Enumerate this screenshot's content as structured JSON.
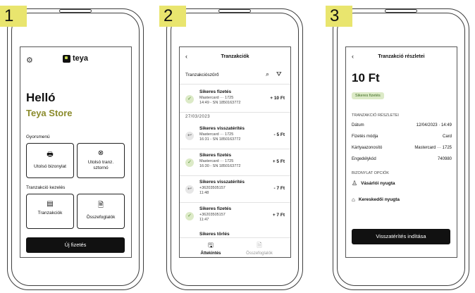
{
  "steps": [
    "1",
    "2",
    "3"
  ],
  "screen1": {
    "brand": "teya",
    "greeting": "Helló",
    "store": "Teya Store",
    "quick_menu_title": "Gyorsmenü",
    "tile_last_receipt": "Utolsó bizonylat",
    "tile_last_tx_cancel_l1": "Utolsó tranz.",
    "tile_last_tx_cancel_l2": "sztornó",
    "tx_manage_title": "Tranzakció kezelés",
    "tile_transactions": "Tranzakciók",
    "tile_summaries": "Összefoglalók",
    "new_payment": "Új fizetés"
  },
  "screen2": {
    "back": "‹",
    "title": "Tranzakciók",
    "filter": "Tranzakciószűrő",
    "date_sep": "27/03/2023",
    "rows": [
      {
        "title": "Sikeres fizetés",
        "l1": "Mastercard ··· 1725",
        "l2": "14:49 - SN 1850163772",
        "amount": "+ 10 Ft",
        "kind": "ok"
      },
      {
        "title": "Sikeres visszatérítés",
        "l1": "Mastercard ··· 1725",
        "l2": "16:31 - SN 1850163772",
        "amount": "- 5 Ft",
        "kind": "ret"
      },
      {
        "title": "Sikeres fizetés",
        "l1": "Mastercard ··· 1725",
        "l2": "16:30 - SN 1850163772",
        "amount": "+ 5 Ft",
        "kind": "ok"
      },
      {
        "title": "Sikeres visszatérítés",
        "l1": "+36203505157",
        "l2": "11:48",
        "amount": "- 7 Ft",
        "kind": "ret"
      },
      {
        "title": "Sikeres fizetés",
        "l1": "+36203505157",
        "l2": "11:47",
        "amount": "+ 7 Ft",
        "kind": "ok"
      }
    ],
    "partial_row": "Sikeres törlés",
    "nav_overview": "Áttekintés",
    "nav_summaries": "Összefoglalók"
  },
  "screen3": {
    "back": "‹",
    "title": "Tranzakció részletei",
    "amount": "10 Ft",
    "status": "Sikeres fizetés",
    "details_title": "TRANZAKCIÓ RÉSZLETEI",
    "details": [
      {
        "k": "Dátum",
        "v": "12/04/2023 · 14:49"
      },
      {
        "k": "Fizetés módja",
        "v": "Card"
      },
      {
        "k": "Kártyaazonosító",
        "v": "Mastercard ··· 1725"
      },
      {
        "k": "Engedélykód",
        "v": "740980"
      }
    ],
    "receipt_title": "BIZONYLAT OPCIÓK",
    "customer_receipt": "Vásárlói nyugta",
    "merchant_receipt": "Kereskedői nyugta",
    "refund_button": "Visszatérítés indítása"
  },
  "colors": {
    "accent_yellow": "#e9e56e",
    "brand_olive": "#8a8a2a",
    "success_green": "#4d8a2c",
    "success_bg": "#dceac7",
    "primary_dark": "#111111"
  }
}
